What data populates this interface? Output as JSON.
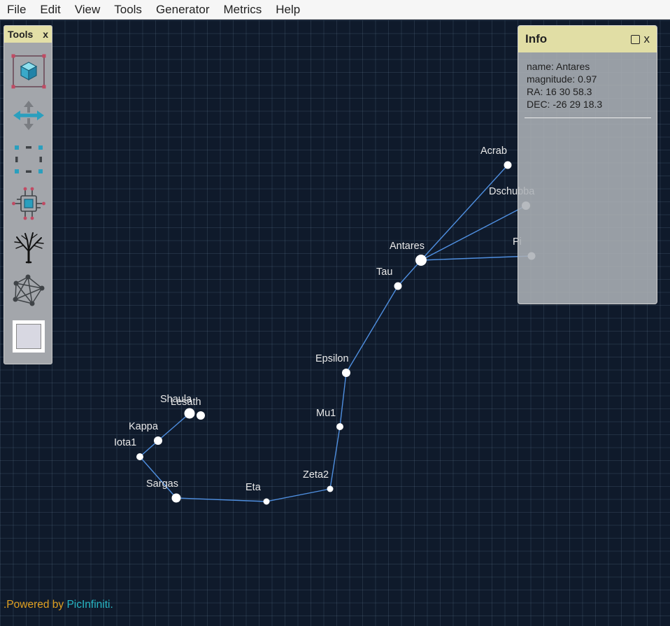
{
  "menu": {
    "items": [
      "File",
      "Edit",
      "View",
      "Tools",
      "Generator",
      "Metrics",
      "Help"
    ]
  },
  "tools_panel": {
    "title": "Tools",
    "close": "x",
    "tools": [
      {
        "name": "cube-select-icon"
      },
      {
        "name": "move-arrows-icon"
      },
      {
        "name": "dashed-selection-icon"
      },
      {
        "name": "circuit-chip-icon"
      },
      {
        "name": "tree-icon"
      },
      {
        "name": "network-graph-icon"
      },
      {
        "name": "color-swatch-icon"
      }
    ],
    "swatch_color": "#d8d8e2"
  },
  "info_panel": {
    "title": "Info",
    "close": "x",
    "lines": [
      "name: Antares",
      "magnitude: 0.97",
      "RA: 16 30 58.3",
      "DEC: -26 29 18.3"
    ]
  },
  "stars": [
    {
      "label": "Acrab"
    },
    {
      "label": "Dschubba"
    },
    {
      "label": "Pi"
    },
    {
      "label": "Antares"
    },
    {
      "label": "Tau"
    },
    {
      "label": "Epsilon"
    },
    {
      "label": "Mu1"
    },
    {
      "label": "Zeta2"
    },
    {
      "label": "Eta"
    },
    {
      "label": "Sargas"
    },
    {
      "label": "Iota1"
    },
    {
      "label": "Kappa"
    },
    {
      "label": "Shaula"
    },
    {
      "label": "Lesath"
    }
  ],
  "footer": {
    "prefix": ".Powered by ",
    "brand": "PicInfiniti."
  },
  "colors": {
    "line": "#4f8fe0",
    "star": "#ffffff",
    "canvas": "#0f1a2b",
    "panel_header": "#e1dea5",
    "footer_prefix": "#e0a020",
    "footer_brand": "#26b6c4"
  }
}
